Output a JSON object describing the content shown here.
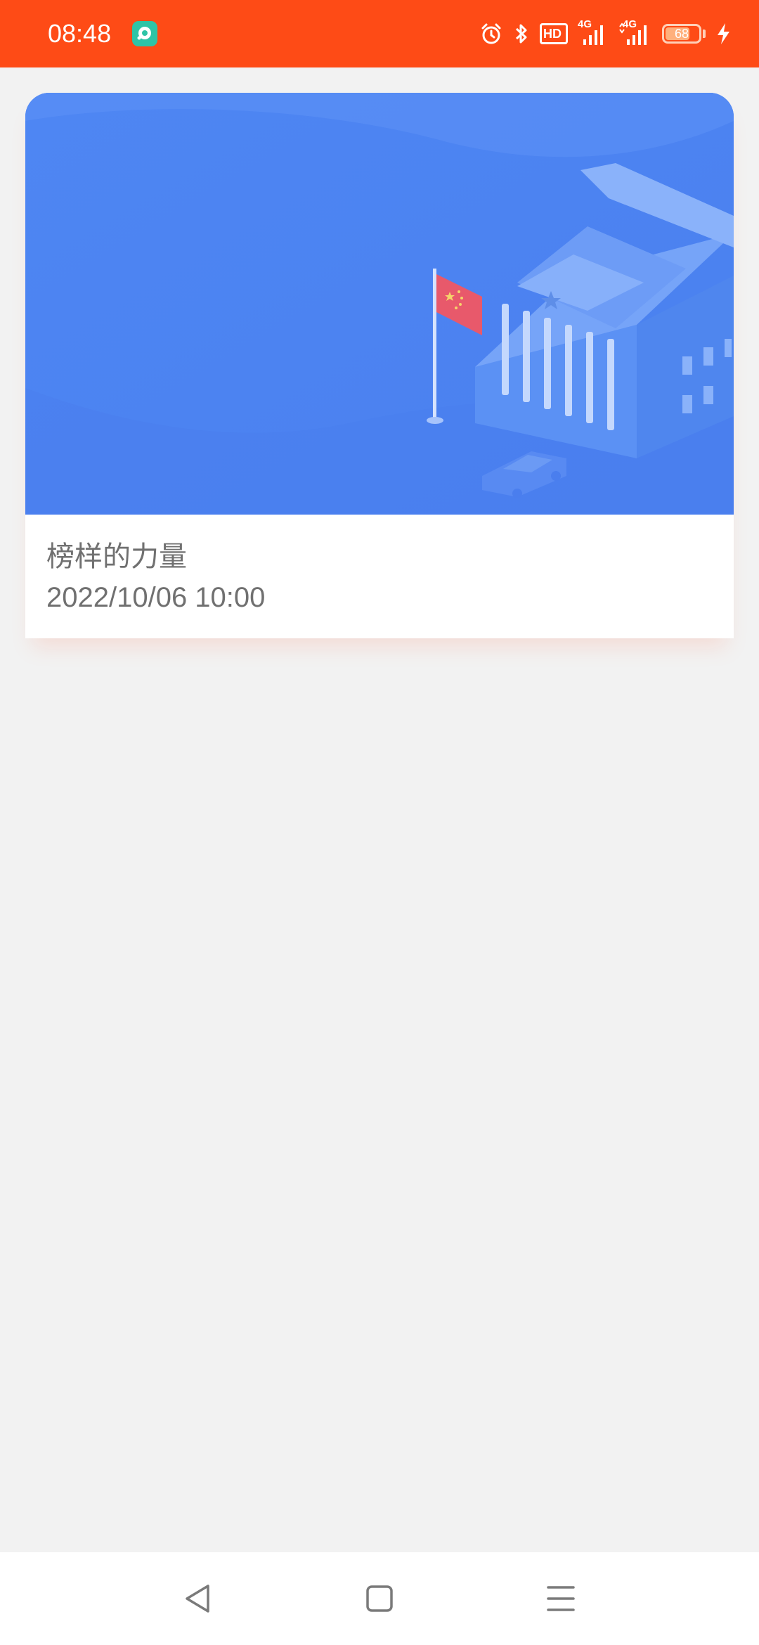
{
  "status_bar": {
    "time": "08:48",
    "battery_level": "68",
    "network_1": "4G",
    "network_2": "4G",
    "hd_label": "HD",
    "background_color": "#fe4b16"
  },
  "card": {
    "title": "榜样的力量",
    "datetime": "2022/10/06 10:00",
    "image_icon": "government-building-flag-illustration"
  },
  "nav_bar": {
    "back_icon": "back-triangle-icon",
    "home_icon": "home-square-icon",
    "menu_icon": "menu-lines-icon"
  }
}
